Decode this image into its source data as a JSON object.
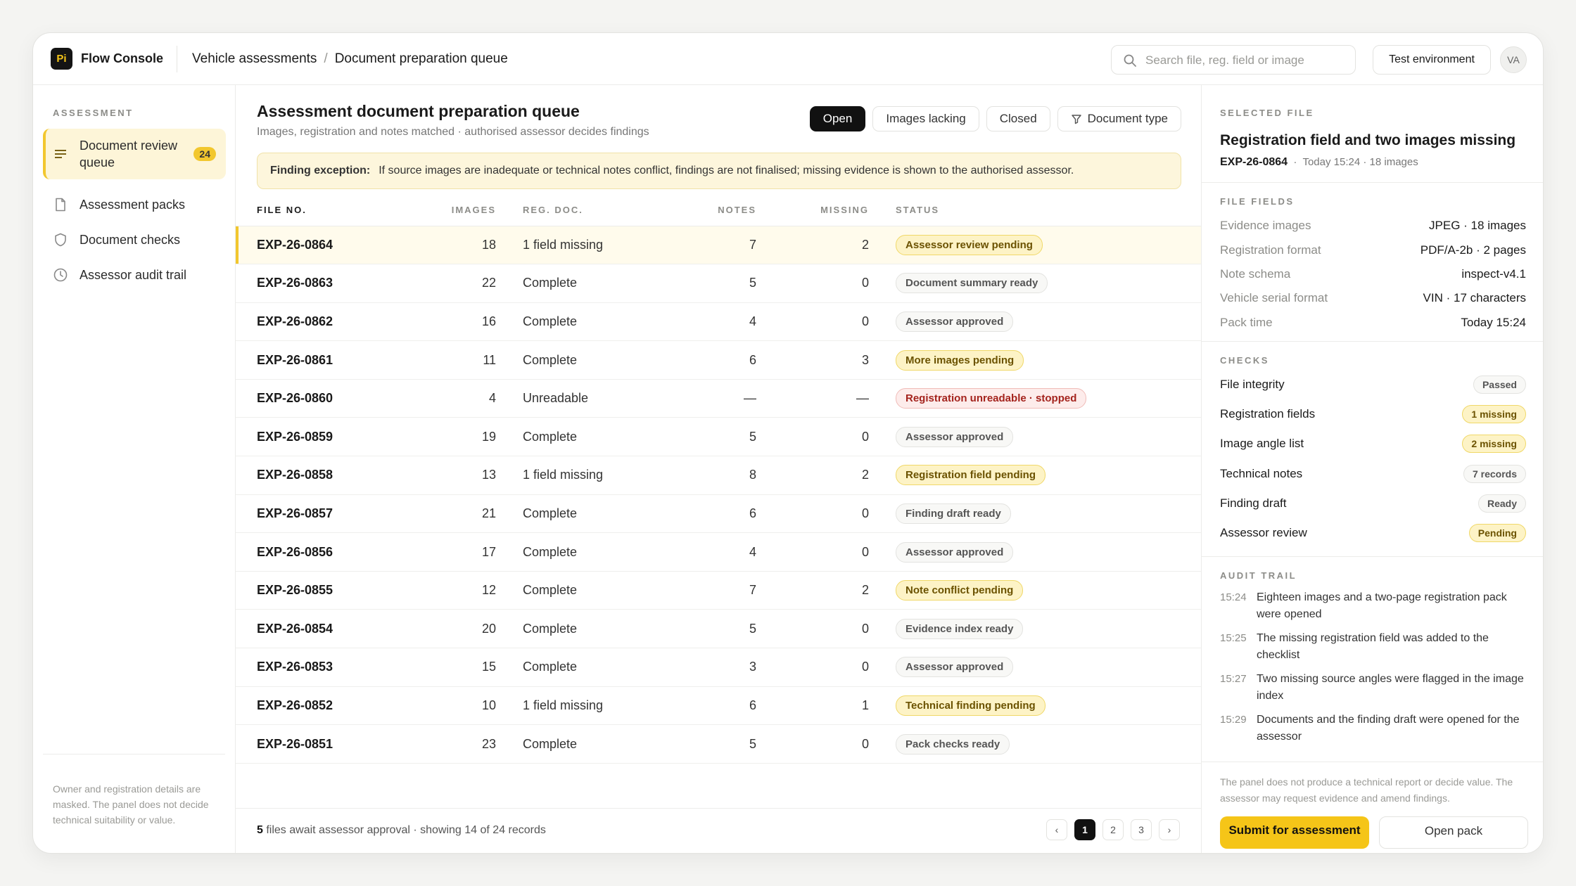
{
  "app": {
    "logo": "Pi",
    "brand": "Flow Console"
  },
  "breadcrumb": [
    "Vehicle assessments",
    "Document preparation queue"
  ],
  "search": {
    "placeholder": "Search file, reg. field or image",
    "value": ""
  },
  "environment": "Test environment",
  "avatar": "VA",
  "sidebar": {
    "heading": "ASSESSMENT",
    "items": [
      {
        "label": "Document review queue",
        "badge": "24",
        "icon": "list-icon",
        "active": true
      },
      {
        "label": "Assessment packs",
        "icon": "file-icon"
      },
      {
        "label": "Document checks",
        "icon": "shield-icon"
      },
      {
        "label": "Assessor audit trail",
        "icon": "clock-icon"
      }
    ],
    "note": "Owner and registration details are masked. The panel does not decide technical suitability or value."
  },
  "main": {
    "title": "Assessment document preparation queue",
    "subtitle": "Images, registration and notes matched · authorised assessor decides findings",
    "filters": [
      "Open",
      "Images lacking",
      "Closed",
      "Document type"
    ],
    "exception": {
      "label": "Finding exception:",
      "text": "If source images are inadequate or technical notes conflict, findings are not finalised; missing evidence is shown to the authorised assessor."
    },
    "columns": [
      "FILE NO.",
      "IMAGES",
      "REG. DOC.",
      "NOTES",
      "MISSING",
      "STATUS"
    ],
    "rows": [
      {
        "file": "EXP-26-0864",
        "images": "18",
        "reg": "1 field missing",
        "notes": "7",
        "missing": "2",
        "status": "Assessor review pending",
        "tone": "warn"
      },
      {
        "file": "EXP-26-0863",
        "images": "22",
        "reg": "Complete",
        "notes": "5",
        "missing": "0",
        "status": "Document summary ready",
        "tone": "neutral"
      },
      {
        "file": "EXP-26-0862",
        "images": "16",
        "reg": "Complete",
        "notes": "4",
        "missing": "0",
        "status": "Assessor approved",
        "tone": "neutral"
      },
      {
        "file": "EXP-26-0861",
        "images": "11",
        "reg": "Complete",
        "notes": "6",
        "missing": "3",
        "status": "More images pending",
        "tone": "warn"
      },
      {
        "file": "EXP-26-0860",
        "images": "4",
        "reg": "Unreadable",
        "notes": "—",
        "missing": "—",
        "status": "Registration unreadable · stopped",
        "tone": "err"
      },
      {
        "file": "EXP-26-0859",
        "images": "19",
        "reg": "Complete",
        "notes": "5",
        "missing": "0",
        "status": "Assessor approved",
        "tone": "neutral"
      },
      {
        "file": "EXP-26-0858",
        "images": "13",
        "reg": "1 field missing",
        "notes": "8",
        "missing": "2",
        "status": "Registration field pending",
        "tone": "warn"
      },
      {
        "file": "EXP-26-0857",
        "images": "21",
        "reg": "Complete",
        "notes": "6",
        "missing": "0",
        "status": "Finding draft ready",
        "tone": "neutral"
      },
      {
        "file": "EXP-26-0856",
        "images": "17",
        "reg": "Complete",
        "notes": "4",
        "missing": "0",
        "status": "Assessor approved",
        "tone": "neutral"
      },
      {
        "file": "EXP-26-0855",
        "images": "12",
        "reg": "Complete",
        "notes": "7",
        "missing": "2",
        "status": "Note conflict pending",
        "tone": "warn"
      },
      {
        "file": "EXP-26-0854",
        "images": "20",
        "reg": "Complete",
        "notes": "5",
        "missing": "0",
        "status": "Evidence index ready",
        "tone": "neutral"
      },
      {
        "file": "EXP-26-0853",
        "images": "15",
        "reg": "Complete",
        "notes": "3",
        "missing": "0",
        "status": "Assessor approved",
        "tone": "neutral"
      },
      {
        "file": "EXP-26-0852",
        "images": "10",
        "reg": "1 field missing",
        "notes": "6",
        "missing": "1",
        "status": "Technical finding pending",
        "tone": "warn"
      },
      {
        "file": "EXP-26-0851",
        "images": "23",
        "reg": "Complete",
        "notes": "5",
        "missing": "0",
        "status": "Pack checks ready",
        "tone": "neutral"
      }
    ],
    "footer": {
      "count": "5",
      "text": " files await assessor approval · showing 14 of 24 records"
    },
    "pager": {
      "prev": "‹",
      "pages": [
        "1",
        "2",
        "3"
      ],
      "next": "›",
      "current": "1"
    }
  },
  "panel": {
    "selected_heading": "SELECTED FILE",
    "title": "Registration field and two images missing",
    "file": "EXP-26-0864",
    "meta": "Today 15:24 · 18 images",
    "fields_heading": "FILE FIELDS",
    "fields": [
      {
        "k": "Evidence images",
        "v": "JPEG · 18 images"
      },
      {
        "k": "Registration format",
        "v": "PDF/A-2b · 2 pages"
      },
      {
        "k": "Note schema",
        "v": "inspect-v4.1"
      },
      {
        "k": "Vehicle serial format",
        "v": "VIN · 17 characters"
      },
      {
        "k": "Pack time",
        "v": "Today 15:24"
      }
    ],
    "checks_heading": "CHECKS",
    "checks": [
      {
        "k": "File integrity",
        "v": "Passed",
        "tone": "neutral"
      },
      {
        "k": "Registration fields",
        "v": "1 missing",
        "tone": "warn"
      },
      {
        "k": "Image angle list",
        "v": "2 missing",
        "tone": "warn"
      },
      {
        "k": "Technical notes",
        "v": "7 records",
        "tone": "neutral"
      },
      {
        "k": "Finding draft",
        "v": "Ready",
        "tone": "neutral"
      },
      {
        "k": "Assessor review",
        "v": "Pending",
        "tone": "warn"
      }
    ],
    "audit_heading": "AUDIT TRAIL",
    "audit": [
      {
        "t": "15:24",
        "text": "Eighteen images and a two-page registration pack were opened"
      },
      {
        "t": "15:25",
        "text": "The missing registration field was added to the checklist"
      },
      {
        "t": "15:27",
        "text": "Two missing source angles were flagged in the image index"
      },
      {
        "t": "15:29",
        "text": "Documents and the finding draft were opened for the assessor"
      }
    ],
    "note": "The panel does not produce a technical report or decide value. The assessor may request evidence and amend findings.",
    "primary": "Submit for assessment",
    "secondary": "Open pack"
  }
}
